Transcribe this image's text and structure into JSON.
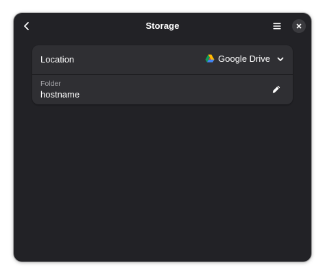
{
  "window": {
    "title": "Storage"
  },
  "location": {
    "label": "Location",
    "selected": "Google Drive"
  },
  "folder": {
    "caption": "Folder",
    "value": "hostname"
  },
  "icons": {
    "back": "back-arrow-icon",
    "menu": "hamburger-menu-icon",
    "close": "close-icon",
    "provider": "google-drive-icon",
    "dropdown": "chevron-down-icon",
    "edit": "pencil-icon"
  },
  "colors": {
    "window_bg": "#222226",
    "card_bg": "#2f2f33",
    "text": "#ffffff",
    "dim_text": "#a8a8ac"
  }
}
